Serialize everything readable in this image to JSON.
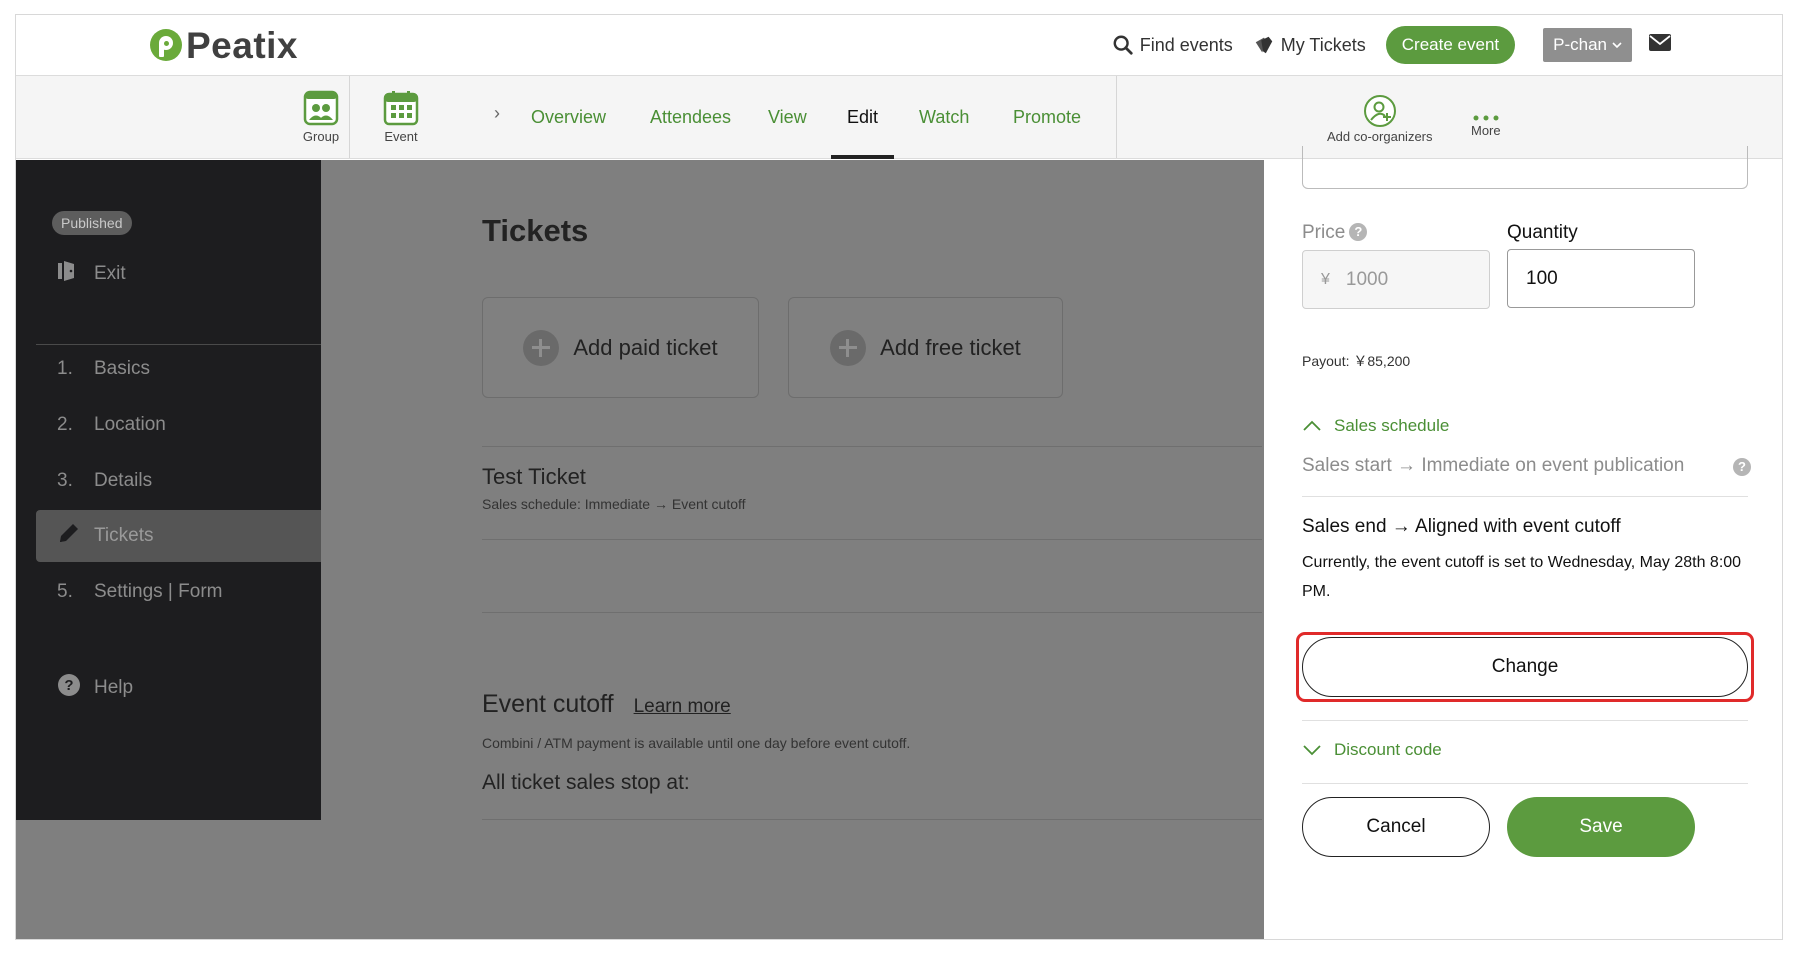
{
  "header": {
    "brand": "Peatix",
    "find_events": "Find events",
    "my_tickets": "My Tickets",
    "create_event": "Create event",
    "user_menu": "P-chan"
  },
  "subnav": {
    "group": "Group",
    "event": "Event",
    "crumb_sep": "›",
    "tabs": [
      "Overview",
      "Attendees",
      "View",
      "Edit",
      "Watch",
      "Promote"
    ],
    "active_tab": "Edit",
    "add_co_organizers": "Add co-organizers",
    "more": "More"
  },
  "sidebar": {
    "status_badge": "Published",
    "exit": "Exit",
    "items": [
      {
        "num": "1.",
        "label": "Basics"
      },
      {
        "num": "2.",
        "label": "Location"
      },
      {
        "num": "3.",
        "label": "Details"
      },
      {
        "num": "",
        "label": "Tickets"
      },
      {
        "num": "5.",
        "label": "Settings | Form"
      }
    ],
    "help": "Help"
  },
  "main": {
    "title": "Tickets",
    "add_paid": "Add paid ticket",
    "add_free": "Add free ticket",
    "ticket_name": "Test Ticket",
    "ticket_schedule": "Sales schedule: Immediate → Event cutoff",
    "cutoff_title": "Event cutoff",
    "learn_more": "Learn more",
    "cutoff_note": "Combini / ATM payment is available until one day before event cutoff.",
    "stop_at": "All ticket sales stop at:"
  },
  "panel": {
    "price_label": "Price",
    "quantity_label": "Quantity",
    "currency": "¥",
    "price_value": "1000",
    "quantity_value": "100",
    "payout": "Payout: ￥85,200",
    "sales_schedule": "Sales schedule",
    "sales_start": "Sales start → Immediate on event publication",
    "sales_end": "Sales end → Aligned with event cutoff",
    "current_cutoff": "Currently, the event cutoff is set to Wednesday, May 28th 8:00 PM.",
    "change": "Change",
    "discount_code": "Discount code",
    "cancel": "Cancel",
    "save": "Save",
    "help_glyph": "?"
  },
  "colors": {
    "brand_green": "#5c9b3f",
    "link_green": "#4a8f35",
    "highlight_red": "#e02a2a"
  }
}
